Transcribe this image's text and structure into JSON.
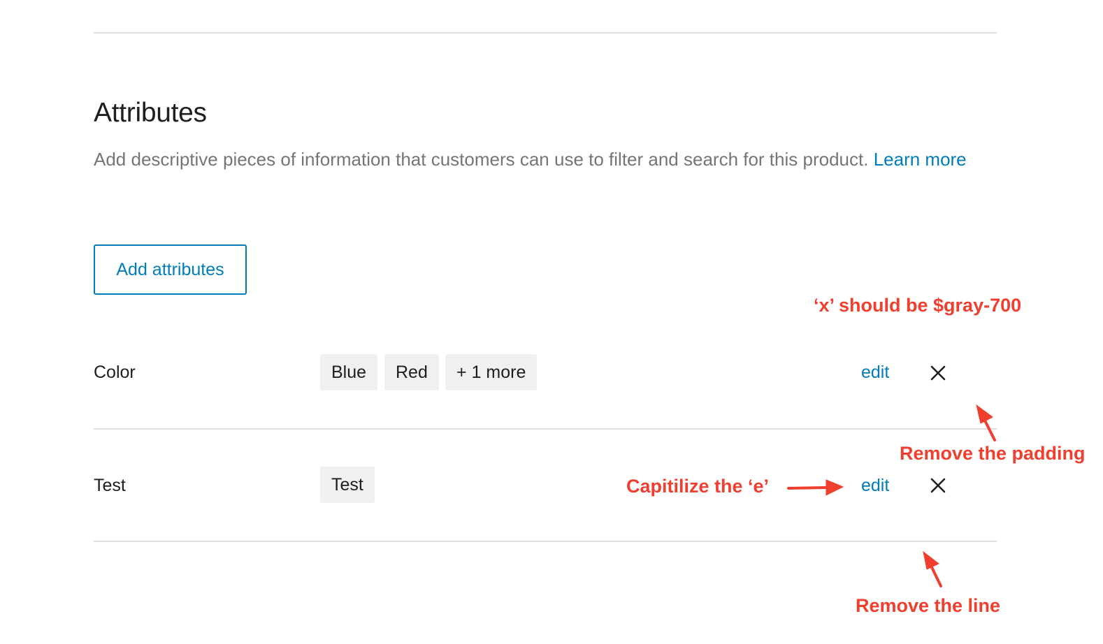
{
  "section": {
    "title": "Attributes",
    "description": "Add descriptive pieces of information that customers can use to filter and search for this product.",
    "learn_more": "Learn more",
    "add_button": "Add attributes"
  },
  "attributes": [
    {
      "name": "Color",
      "values": [
        "Blue",
        "Red",
        "+ 1 more"
      ],
      "edit_label": "edit",
      "remove_icon": "close-icon"
    },
    {
      "name": "Test",
      "values": [
        "Test"
      ],
      "edit_label": "edit",
      "remove_icon": "close-icon"
    }
  ],
  "annotations": {
    "x_color": "‘x’ should be $gray-700",
    "remove_padding": "Remove the padding",
    "capitalize": "Capitilize the ‘e’",
    "remove_line": "Remove the line"
  },
  "colors": {
    "accent": "#007cba",
    "text": "#1e1e1e",
    "muted": "#757575",
    "chip_bg": "#f0f0f0",
    "divider": "#e0e0e0",
    "annotation": "#f03e2f"
  }
}
